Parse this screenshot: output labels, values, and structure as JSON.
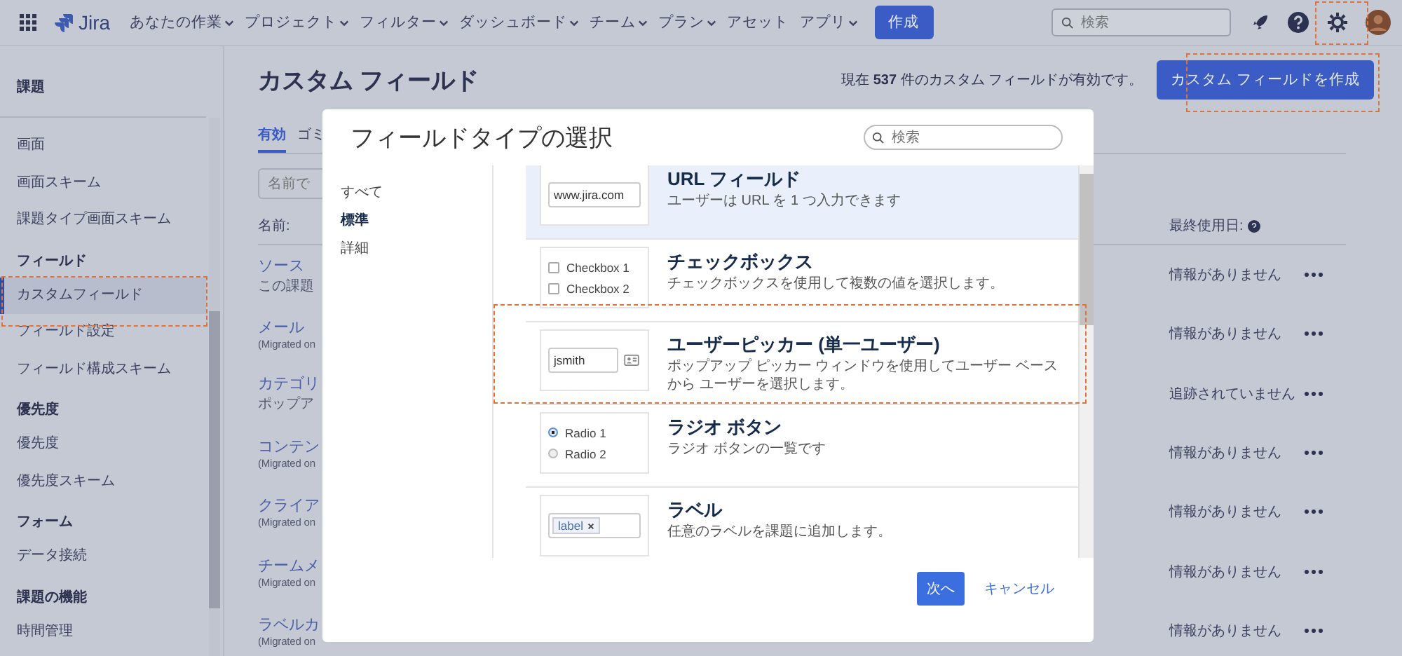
{
  "nav": {
    "product": "Jira",
    "items": [
      {
        "label": "あなたの作業",
        "dropdown": true
      },
      {
        "label": "プロジェクト",
        "dropdown": true
      },
      {
        "label": "フィルター",
        "dropdown": true
      },
      {
        "label": "ダッシュボード",
        "dropdown": true
      },
      {
        "label": "チーム",
        "dropdown": true
      },
      {
        "label": "プラン",
        "dropdown": true
      },
      {
        "label": "アセット",
        "dropdown": false
      },
      {
        "label": "アプリ",
        "dropdown": true
      }
    ],
    "create": "作成",
    "search": {
      "placeholder": "検索"
    }
  },
  "sidebar": {
    "title": "課題",
    "items": [
      {
        "kind": "link",
        "label": "画面",
        "selected": false
      },
      {
        "kind": "link",
        "label": "画面スキーム",
        "selected": false
      },
      {
        "kind": "link",
        "label": "課題タイプ画面スキーム",
        "selected": false
      },
      {
        "kind": "heading",
        "label": "フィールド"
      },
      {
        "kind": "link",
        "label": "カスタムフィールド",
        "selected": true
      },
      {
        "kind": "link",
        "label": "フィールド設定",
        "selected": false
      },
      {
        "kind": "link",
        "label": "フィールド構成スキーム",
        "selected": false
      },
      {
        "kind": "heading",
        "label": "優先度"
      },
      {
        "kind": "link",
        "label": "優先度",
        "selected": false
      },
      {
        "kind": "link",
        "label": "優先度スキーム",
        "selected": false
      },
      {
        "kind": "heading",
        "label": "フォーム"
      },
      {
        "kind": "link",
        "label": "データ接続",
        "selected": false
      },
      {
        "kind": "heading",
        "label": "課題の機能"
      },
      {
        "kind": "link",
        "label": "時間管理",
        "selected": false
      }
    ]
  },
  "page": {
    "title": "カスタム フィールド",
    "summary": "現在 **537** 件のカスタム フィールドが有効です。",
    "create_button": "カスタム フィールドを作成",
    "tabs": [
      {
        "label": "有効",
        "selected": true
      },
      {
        "label": "ゴミ",
        "selected": false
      }
    ],
    "filter": {
      "placeholder": "名前で"
    },
    "columns": [
      "名前:",
      "最終使用日:"
    ],
    "rows": [
      {
        "name": "ソース",
        "subtitle": "この課題",
        "last_used": "情報がありません"
      },
      {
        "name": "メール",
        "subtitle": "(Migrated on",
        "last_used": "情報がありません"
      },
      {
        "name": "カテゴリ",
        "subtitle": "ポップア",
        "last_used": "追跡されていません"
      },
      {
        "name": "コンテン",
        "subtitle": "(Migrated on",
        "last_used": "情報がありません"
      },
      {
        "name": "クライア",
        "subtitle": "(Migrated on",
        "last_used": "情報がありません"
      },
      {
        "name": "チームメ",
        "subtitle": "(Migrated on",
        "last_used": "情報がありません"
      },
      {
        "name": "ラベルカ",
        "subtitle": "(Migrated on",
        "last_used": "情報がありません"
      }
    ]
  },
  "dialog": {
    "title": "フィールドタイプの選択",
    "search": {
      "placeholder": "検索"
    },
    "categories": [
      {
        "label": "すべて",
        "selected": false
      },
      {
        "label": "標準",
        "selected": true
      },
      {
        "label": "詳細",
        "selected": false
      }
    ],
    "field_types": [
      {
        "kind": "url",
        "title": "URL フィールド",
        "description": "ユーザーは URL を 1 つ入力できます",
        "selected": true,
        "preview": {
          "value": "www.jira.com"
        }
      },
      {
        "kind": "checkbox",
        "title": "チェックボックス",
        "description": "チェックボックスを使用して複数の値を選択します。",
        "selected": false,
        "preview": {
          "options": [
            {
              "label": "Checkbox 1",
              "checked": false
            },
            {
              "label": "Checkbox 2",
              "checked": false
            }
          ]
        }
      },
      {
        "kind": "userpicker",
        "title": "ユーザーピッカー (単一ユーザー)",
        "description": "ポップアップ ピッカー ウィンドウを使用してユーザー ベースから ユーザーを選択します。",
        "selected": false,
        "preview": {
          "value": "jsmith"
        }
      },
      {
        "kind": "radio",
        "title": "ラジオ ボタン",
        "description": "ラジオ ボタンの一覧です",
        "selected": false,
        "preview": {
          "options": [
            {
              "label": "Radio 1",
              "checked": true
            },
            {
              "label": "Radio 2",
              "checked": false
            }
          ]
        }
      },
      {
        "kind": "label",
        "title": "ラベル",
        "description": "任意のラベルを課題に追加します。",
        "selected": false,
        "preview": {
          "tag": "label"
        }
      }
    ],
    "next": "次へ",
    "cancel": "キャンセル"
  }
}
